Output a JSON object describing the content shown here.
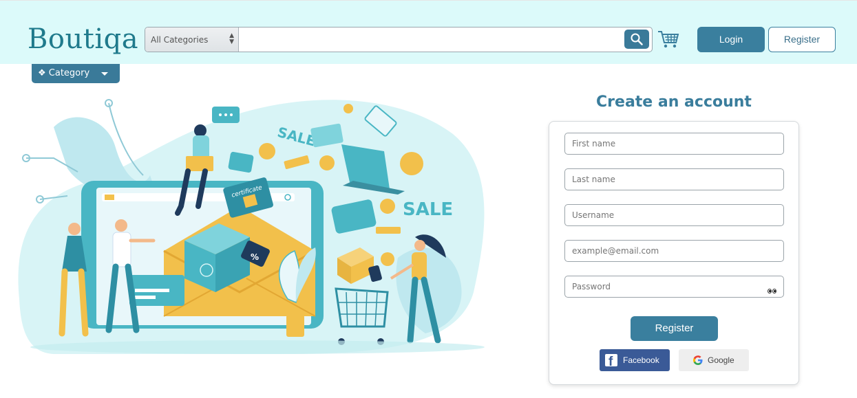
{
  "header": {
    "logo": "Boutiqa",
    "search": {
      "category_label": "All Categories",
      "placeholder": ""
    },
    "login_label": "Login",
    "register_label": "Register"
  },
  "nav": {
    "category_label": "❖ Category"
  },
  "hero": {
    "sale_text_1": "SALE",
    "sale_text_2": "SALE",
    "certificate_text": "certificate",
    "discount_text": "%"
  },
  "form": {
    "title": "Create an account",
    "first_name_placeholder": "First name",
    "last_name_placeholder": "Last name",
    "username_placeholder": "Username",
    "email_placeholder": "example@email.com",
    "password_placeholder": "Password",
    "register_label": "Register",
    "facebook_label": "Facebook",
    "google_label": "Google"
  },
  "colors": {
    "header_bg": "#dcfafa",
    "brand": "#1f7a8c",
    "primary_button": "#3a7f9e",
    "facebook": "#3a5a97"
  }
}
